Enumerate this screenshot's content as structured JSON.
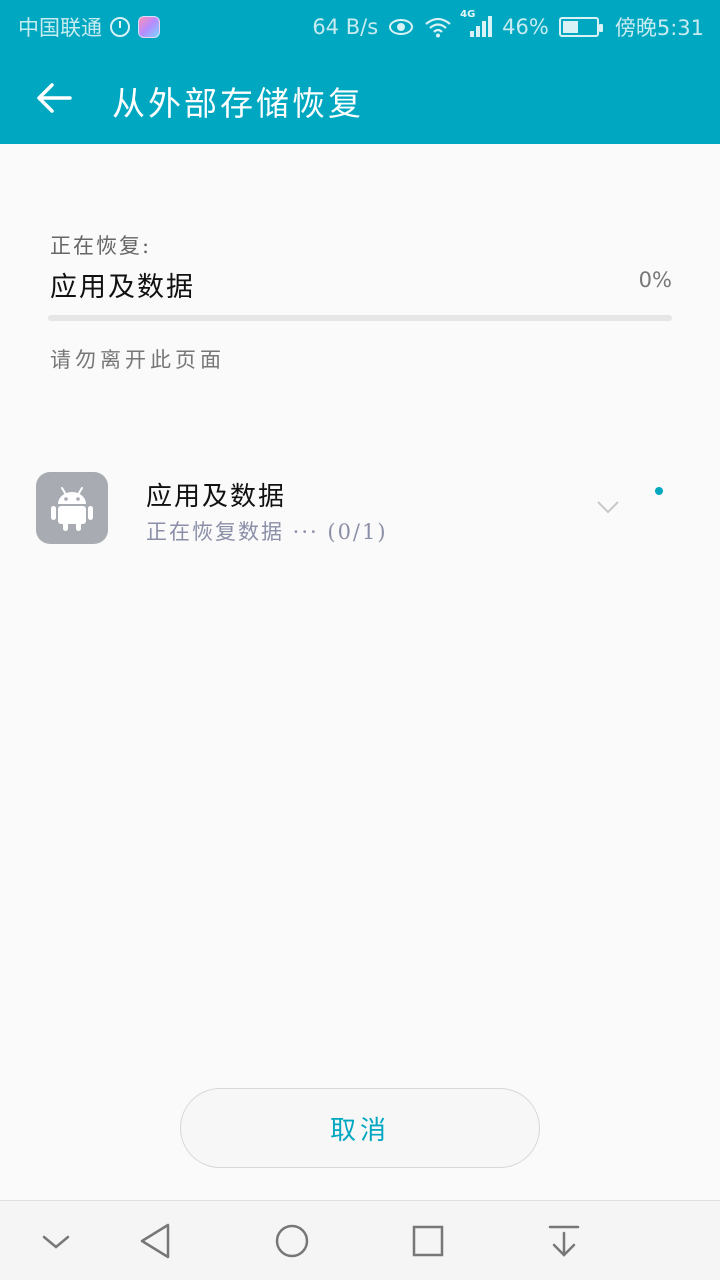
{
  "status_bar": {
    "carrier": "中国联通",
    "net_speed": "64 B/s",
    "network_type": "4G",
    "battery": "46%",
    "battery_level": 0.46,
    "time": "傍晚5:31"
  },
  "header": {
    "title": "从外部存储恢复",
    "back_icon": "arrow-left-icon"
  },
  "restore": {
    "label": "正在恢复:",
    "item": "应用及数据",
    "percent": "0%",
    "progress": 0,
    "hint": "请勿离开此页面"
  },
  "list": {
    "items": [
      {
        "title": "应用及数据",
        "subtitle": "正在恢复数据 ··· (0/1)",
        "icon": "android-icon"
      }
    ]
  },
  "actions": {
    "cancel_label": "取消"
  },
  "navbar": {
    "icons": [
      "chevron-down-icon",
      "back-triangle-icon",
      "home-circle-icon",
      "recent-square-icon",
      "notification-pull-icon"
    ]
  },
  "colors": {
    "accent": "#00a7c0",
    "background": "#fafafa"
  }
}
